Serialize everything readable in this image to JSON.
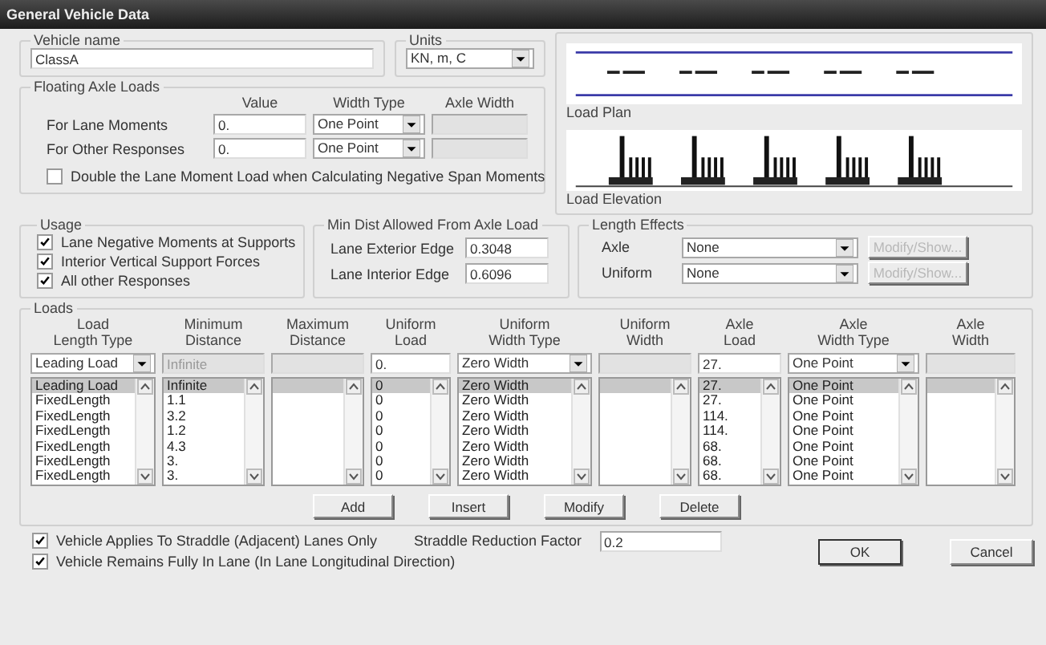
{
  "window": {
    "title": "General Vehicle Data"
  },
  "vehicle_name": {
    "label": "Vehicle name",
    "value": "ClassA"
  },
  "units": {
    "label": "Units",
    "value": "KN, m, C"
  },
  "floating_axle_loads": {
    "title": "Floating Axle Loads",
    "columns": [
      "Value",
      "Width Type",
      "Axle Width"
    ],
    "rows": [
      {
        "label": "For Lane Moments",
        "value": "0.",
        "width_type": "One Point"
      },
      {
        "label": "For Other Responses",
        "value": "0.",
        "width_type": "One Point"
      }
    ],
    "double_option": {
      "label": "Double the Lane Moment Load when Calculating Negative Span Moments",
      "checked": false
    }
  },
  "preview": {
    "plan_label": "Load Plan",
    "elevation_label": "Load Elevation"
  },
  "usage": {
    "title": "Usage",
    "options": [
      {
        "label": "Lane Negative Moments at Supports",
        "checked": true
      },
      {
        "label": "Interior Vertical Support Forces",
        "checked": true
      },
      {
        "label": "All other Responses",
        "checked": true
      }
    ]
  },
  "min_dist": {
    "title": "Min Dist Allowed From Axle Load",
    "fields": [
      {
        "label": "Lane Exterior Edge",
        "value": "0.3048"
      },
      {
        "label": "Lane Interior Edge",
        "value": "0.6096"
      }
    ]
  },
  "length_effects": {
    "title": "Length Effects",
    "rows": [
      {
        "label": "Axle",
        "value": "None",
        "button": "Modify/Show...",
        "disabled": true
      },
      {
        "label": "Uniform",
        "value": "None",
        "button": "Modify/Show...",
        "disabled": true
      }
    ]
  },
  "loads": {
    "title": "Loads",
    "columns": [
      {
        "header": [
          "Load",
          "Length Type"
        ],
        "entry": {
          "kind": "select",
          "value": "Leading Load"
        }
      },
      {
        "header": [
          "Minimum",
          "Distance"
        ],
        "entry": {
          "kind": "input",
          "disabled": true,
          "value": "Infinite"
        }
      },
      {
        "header": [
          "Maximum",
          "Distance"
        ],
        "entry": {
          "kind": "input",
          "disabled": true
        }
      },
      {
        "header": [
          "Uniform",
          "Load"
        ],
        "entry": {
          "kind": "input",
          "disabled": false,
          "value": "0."
        }
      },
      {
        "header": [
          "Uniform",
          "Width Type"
        ],
        "entry": {
          "kind": "select",
          "value": "Zero Width"
        }
      },
      {
        "header": [
          "Uniform",
          "Width"
        ],
        "entry": {
          "kind": "input",
          "disabled": true
        }
      },
      {
        "header": [
          "Axle",
          "Load"
        ],
        "entry": {
          "kind": "input",
          "disabled": false,
          "value": "27."
        }
      },
      {
        "header": [
          "Axle",
          "Width Type"
        ],
        "entry": {
          "kind": "select",
          "value": "One Point"
        }
      },
      {
        "header": [
          "Axle",
          "Width"
        ],
        "entry": {
          "kind": "input",
          "disabled": true
        }
      }
    ],
    "rows": [
      {
        "selected": true,
        "cells": [
          "Leading Load",
          "Infinite",
          null,
          "0",
          "Zero Width",
          null,
          "27.",
          "One Point",
          null
        ]
      },
      {
        "selected": false,
        "cells": [
          "FixedLength",
          "1.1",
          null,
          "0",
          "Zero Width",
          null,
          "27.",
          "One Point",
          null
        ]
      },
      {
        "selected": false,
        "cells": [
          "FixedLength",
          "3.2",
          null,
          "0",
          "Zero Width",
          null,
          "114.",
          "One Point",
          null
        ]
      },
      {
        "selected": false,
        "cells": [
          "FixedLength",
          "1.2",
          null,
          "0",
          "Zero Width",
          null,
          "114.",
          "One Point",
          null
        ]
      },
      {
        "selected": false,
        "cells": [
          "FixedLength",
          "4.3",
          null,
          "0",
          "Zero Width",
          null,
          "68.",
          "One Point",
          null
        ]
      },
      {
        "selected": false,
        "cells": [
          "FixedLength",
          "3.",
          null,
          "0",
          "Zero Width",
          null,
          "68.",
          "One Point",
          null
        ]
      },
      {
        "selected": false,
        "cells": [
          "FixedLength",
          "3.",
          null,
          "0",
          "Zero Width",
          null,
          "68.",
          "One Point",
          null
        ]
      }
    ],
    "buttons": [
      "Add",
      "Insert",
      "Modify",
      "Delete"
    ]
  },
  "straddle_options": [
    {
      "label": "Vehicle Applies To Straddle (Adjacent) Lanes Only",
      "checked": true
    },
    {
      "label": "Vehicle Remains Fully In Lane (In Lane Longitudinal Direction)",
      "checked": true
    }
  ],
  "straddle_factor": {
    "label": "Straddle Reduction Factor",
    "value": "0.2"
  },
  "dialog_buttons": [
    "OK",
    "Cancel"
  ]
}
